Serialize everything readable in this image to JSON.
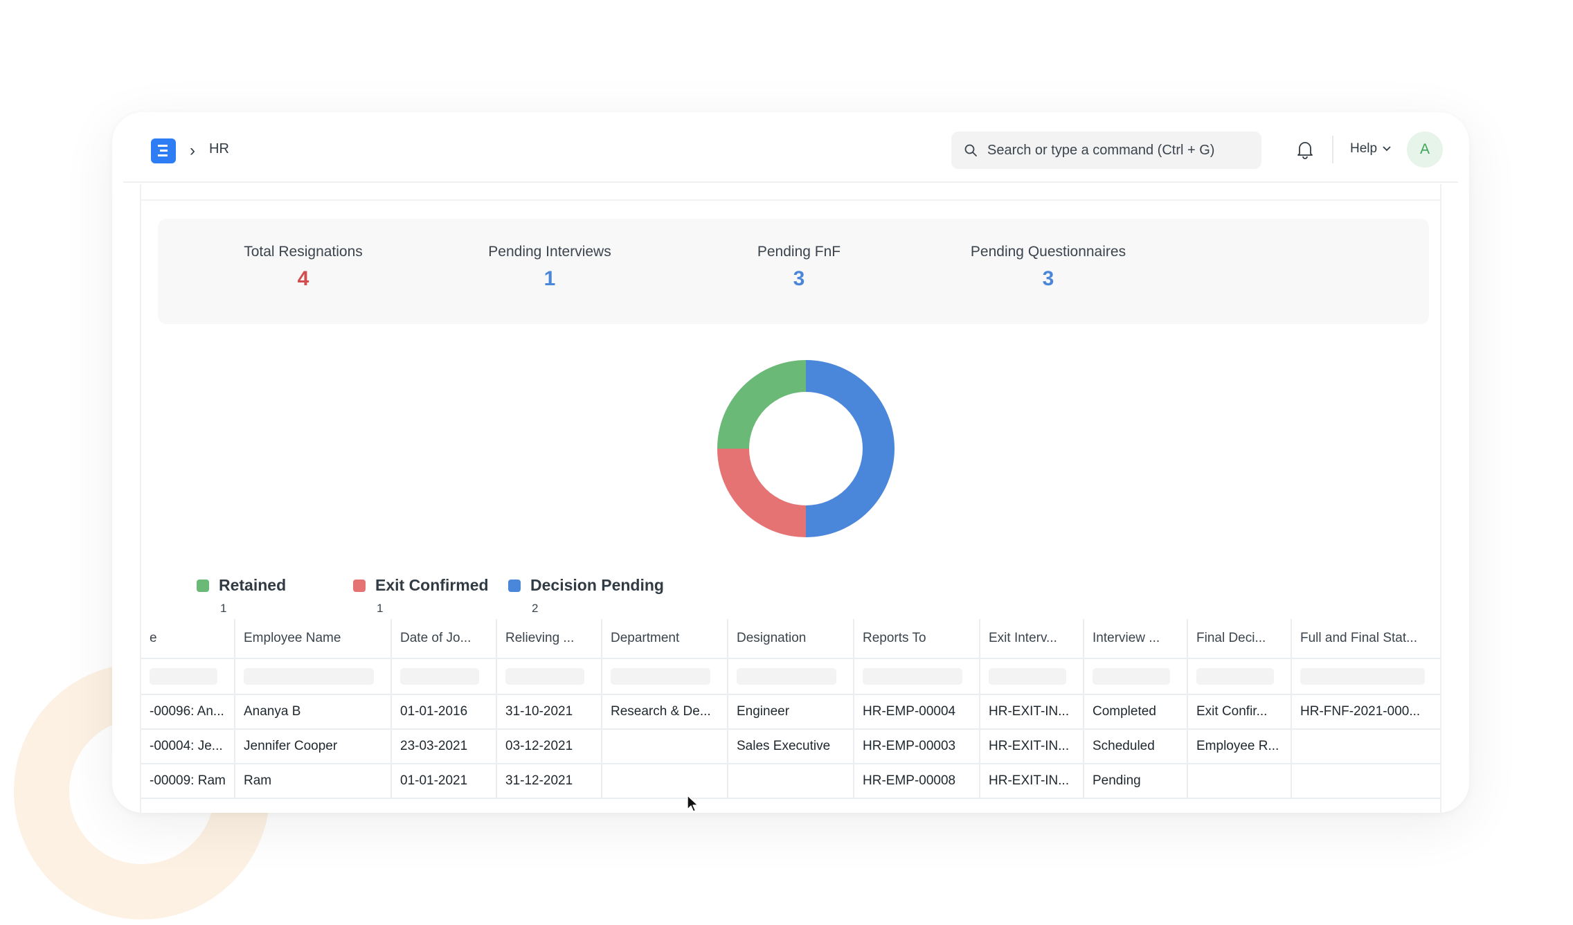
{
  "navbar": {
    "breadcrumb": "HR",
    "search_placeholder": "Search or type a command (Ctrl + G)",
    "help_label": "Help",
    "avatar_initial": "A"
  },
  "cards": [
    {
      "label": "Total Resignations",
      "value": "4",
      "color": "#d24e4e"
    },
    {
      "label": "Pending Interviews",
      "value": "1",
      "color": "#4a86d9"
    },
    {
      "label": "Pending FnF",
      "value": "3",
      "color": "#4a86d9"
    },
    {
      "label": "Pending Questionnaires",
      "value": "3",
      "color": "#4a86d9"
    }
  ],
  "chart_data": {
    "type": "pie",
    "categories": [
      "Retained",
      "Exit Confirmed",
      "Decision Pending"
    ],
    "values": [
      1,
      1,
      2
    ],
    "colors": [
      "#6bb977",
      "#e57373",
      "#4a86d9"
    ],
    "legend": "bottom-left"
  },
  "table": {
    "columns": [
      "e",
      "Employee Name",
      "Date of Jo...",
      "Relieving ...",
      "Department",
      "Designation",
      "Reports To",
      "Exit Interv...",
      "Interview ...",
      "Final Deci...",
      "Full and Final Stat..."
    ],
    "rows": [
      [
        "-00096: An...",
        "Ananya B",
        "01-01-2016",
        "31-10-2021",
        "Research & De...",
        "Engineer",
        "HR-EMP-00004",
        "HR-EXIT-IN...",
        "Completed",
        "Exit Confir...",
        "HR-FNF-2021-000..."
      ],
      [
        "-00004: Je...",
        "Jennifer Cooper",
        "23-03-2021",
        "03-12-2021",
        "",
        "Sales Executive",
        "HR-EMP-00003",
        "HR-EXIT-IN...",
        "Scheduled",
        "Employee R...",
        ""
      ],
      [
        "-00009: Ram",
        "Ram",
        "01-01-2021",
        "31-12-2021",
        "",
        "",
        "HR-EMP-00008",
        "HR-EXIT-IN...",
        "Pending",
        "",
        ""
      ]
    ]
  }
}
